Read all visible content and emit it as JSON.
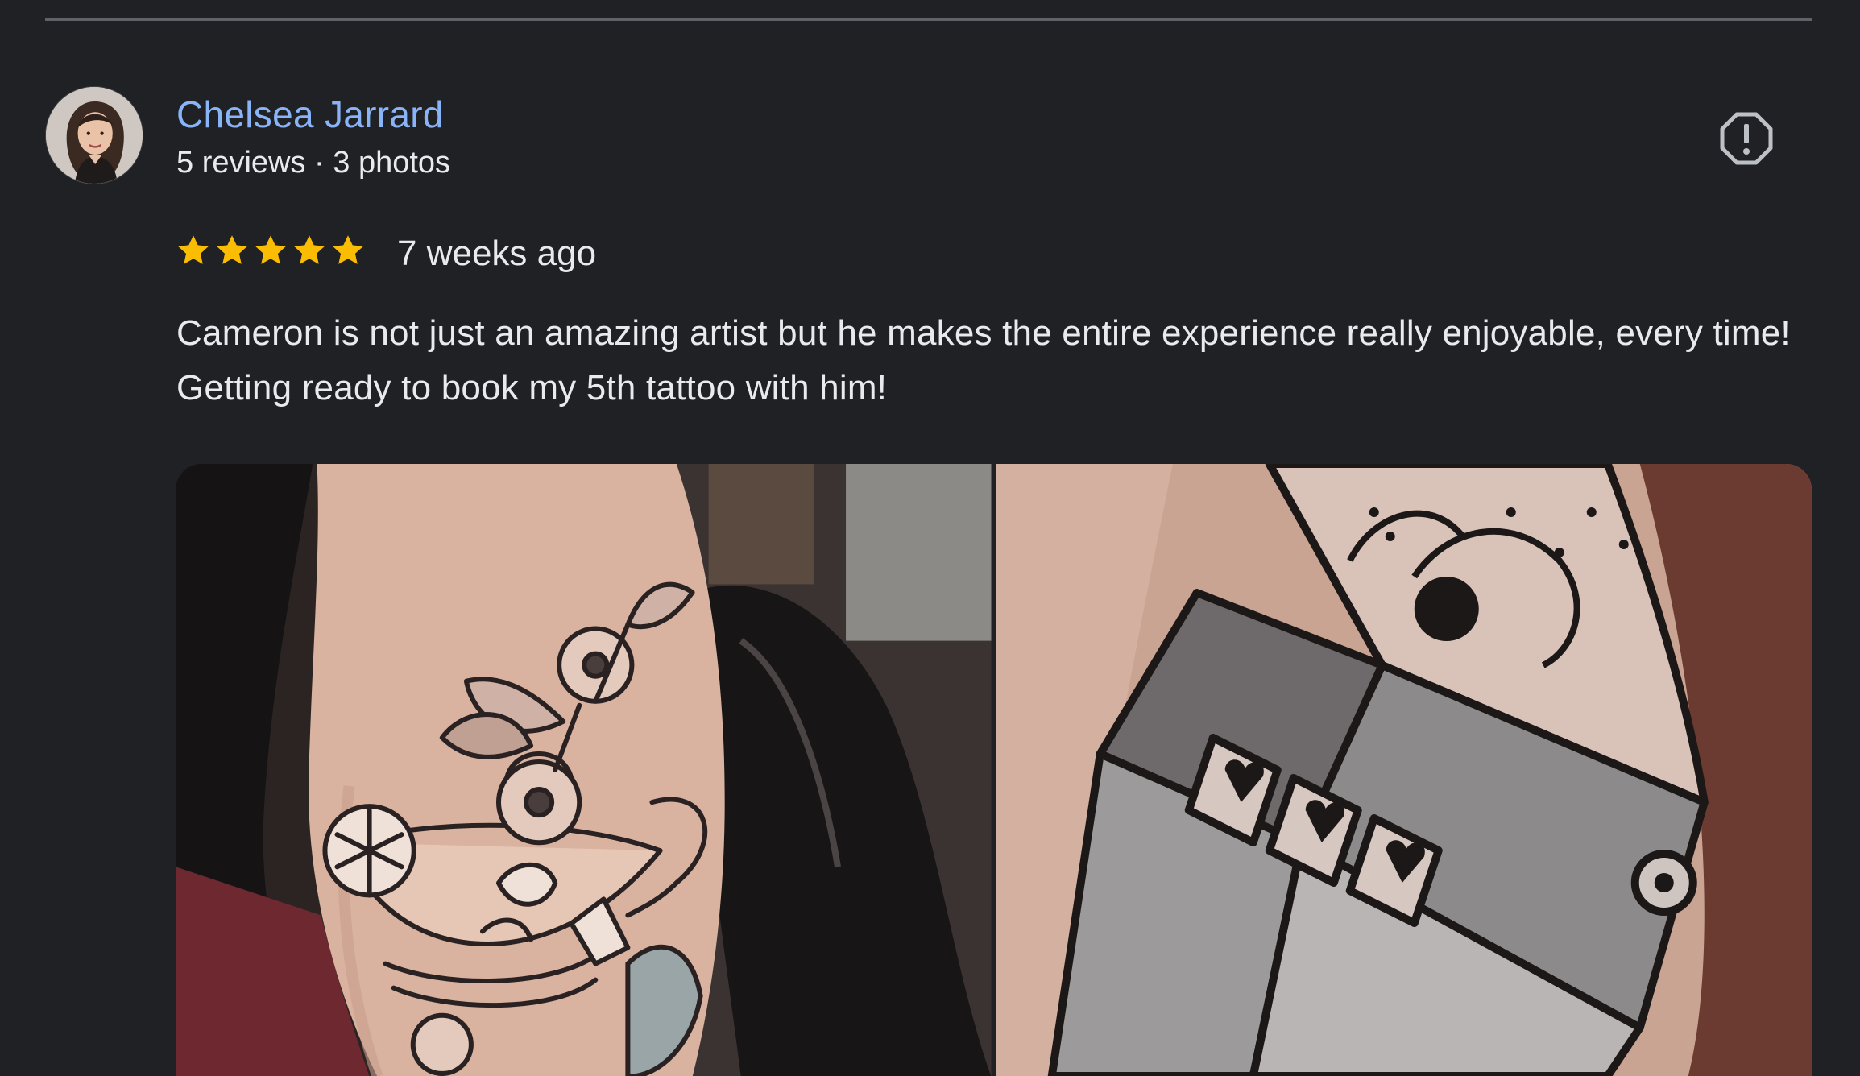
{
  "review": {
    "reviewer_name": "Chelsea Jarrard",
    "reviewer_meta": "5 reviews · 3 photos",
    "rating": 5,
    "time_ago": "7 weeks ago",
    "text": "Cameron is not just an amazing artist but he makes the entire experience really enjoyable, every time! Getting ready to book my 5th tattoo with him!",
    "photos": [
      {
        "subject": "teacup-flower-tattoo"
      },
      {
        "subject": "slot-machine-heart-tattoo"
      }
    ]
  },
  "colors": {
    "background": "#202124",
    "link": "#8ab4f8",
    "star": "#fbbc04",
    "text": "#e8eaed",
    "icon": "#bdc1c6"
  },
  "icons": [
    "avatar",
    "report-icon",
    "star-icon"
  ]
}
